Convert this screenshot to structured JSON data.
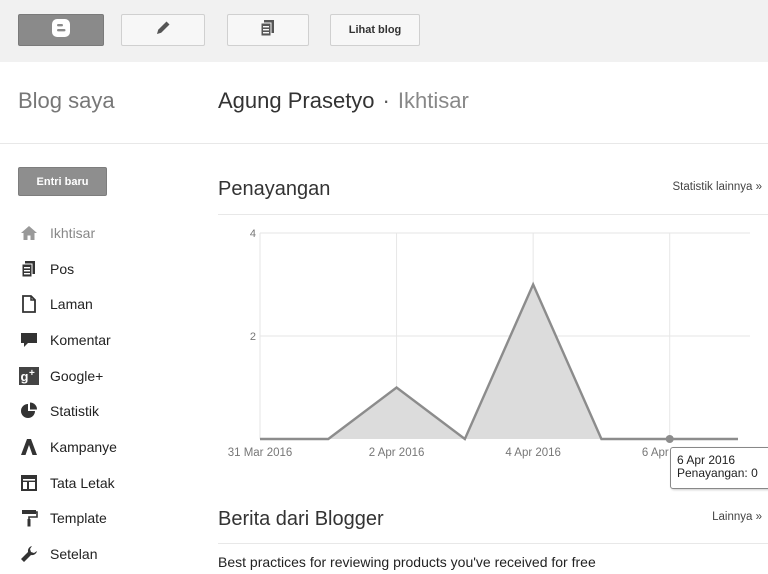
{
  "topbar": {
    "buttons": [
      {
        "icon": "blogger-logo-icon"
      },
      {
        "icon": "pencil-icon"
      },
      {
        "icon": "posts-icon"
      }
    ],
    "view_blog_label": "Lihat blog"
  },
  "sidebar": {
    "title": "Blog saya",
    "new_post_label": "Entri baru",
    "items": [
      {
        "label": "Ikhtisar",
        "icon": "home-icon",
        "active": true
      },
      {
        "label": "Pos",
        "icon": "posts-icon"
      },
      {
        "label": "Laman",
        "icon": "page-icon"
      },
      {
        "label": "Komentar",
        "icon": "comment-icon"
      },
      {
        "label": "Google+",
        "icon": "google-plus-icon"
      },
      {
        "label": "Statistik",
        "icon": "pie-chart-icon"
      },
      {
        "label": "Kampanye",
        "icon": "campaign-icon"
      },
      {
        "label": "Tata Letak",
        "icon": "layout-icon"
      },
      {
        "label": "Template",
        "icon": "paint-roller-icon"
      },
      {
        "label": "Setelan",
        "icon": "wrench-icon"
      }
    ]
  },
  "header": {
    "blog_name": "Agung Prasetyo",
    "separator": "·",
    "page": "Ikhtisar"
  },
  "stats": {
    "title": "Penayangan",
    "more_label": "Statistik lainnya »"
  },
  "chart_data": {
    "type": "area",
    "x": [
      "31 Mar 2016",
      "1 Apr 2016",
      "2 Apr 2016",
      "3 Apr 2016",
      "4 Apr 2016",
      "5 Apr 2016",
      "6 Apr 2016",
      "7 Apr 2016"
    ],
    "series": [
      {
        "values": [
          0,
          0,
          1,
          0,
          3,
          0,
          0,
          0
        ]
      }
    ],
    "xtick_labels": [
      "31 Mar 2016",
      "2 Apr 2016",
      "4 Apr 2016",
      "6 Apr 2016"
    ],
    "ytick_labels": [
      "4",
      "2"
    ],
    "ylim": [
      0,
      4
    ],
    "grid": true,
    "line_color": "#8c8c8c",
    "fill_color": "#dcdcdc",
    "grid_color": "#e6e6e6",
    "highlight_index": 6
  },
  "tooltip": {
    "date": "6 Apr 2016",
    "text": "Penayangan: 0"
  },
  "news": {
    "title": "Berita dari Blogger",
    "more_label": "Lainnya »",
    "item": "Best practices for reviewing products you've received for free"
  }
}
